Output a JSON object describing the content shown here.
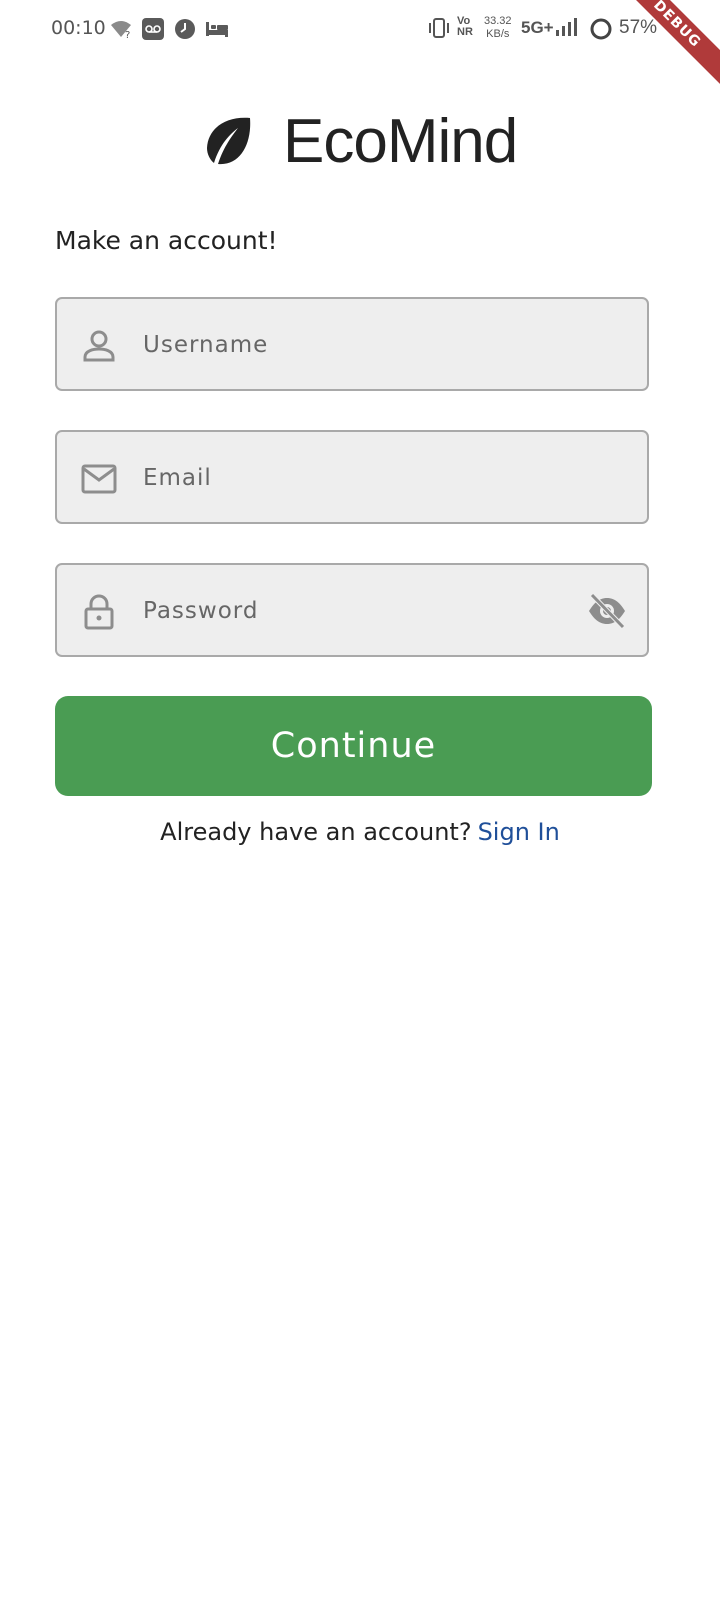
{
  "status_bar": {
    "time": "00:10",
    "network_speed_value": "33.32",
    "network_speed_unit": "KB/s",
    "volte_top": "Vo",
    "volte_bottom": "NR",
    "network_type": "5G+",
    "battery": "57%",
    "icons": [
      "wifi-unknown-icon",
      "voicemail-icon",
      "clock-icon",
      "bed-icon",
      "vibrate-icon",
      "signal-icon",
      "battery-icon"
    ]
  },
  "debug_banner": "DEBUG",
  "app": {
    "name": "EcoMind",
    "logo_icon": "leaf-icon"
  },
  "form": {
    "heading": "Make an account!",
    "username": {
      "placeholder": "Username",
      "value": "",
      "icon": "person-icon"
    },
    "email": {
      "placeholder": "Email",
      "value": "",
      "icon": "mail-icon"
    },
    "password": {
      "placeholder": "Password",
      "value": "",
      "icon": "lock-icon",
      "toggle_icon": "eye-off-icon"
    },
    "continue_label": "Continue",
    "signin_prompt": "Already have an account?",
    "signin_link": "Sign In"
  },
  "colors": {
    "accent_green": "#4a9c53",
    "link_blue": "#1f4f99",
    "field_bg": "#eeeeee",
    "debug_red": "#b03a3a"
  }
}
